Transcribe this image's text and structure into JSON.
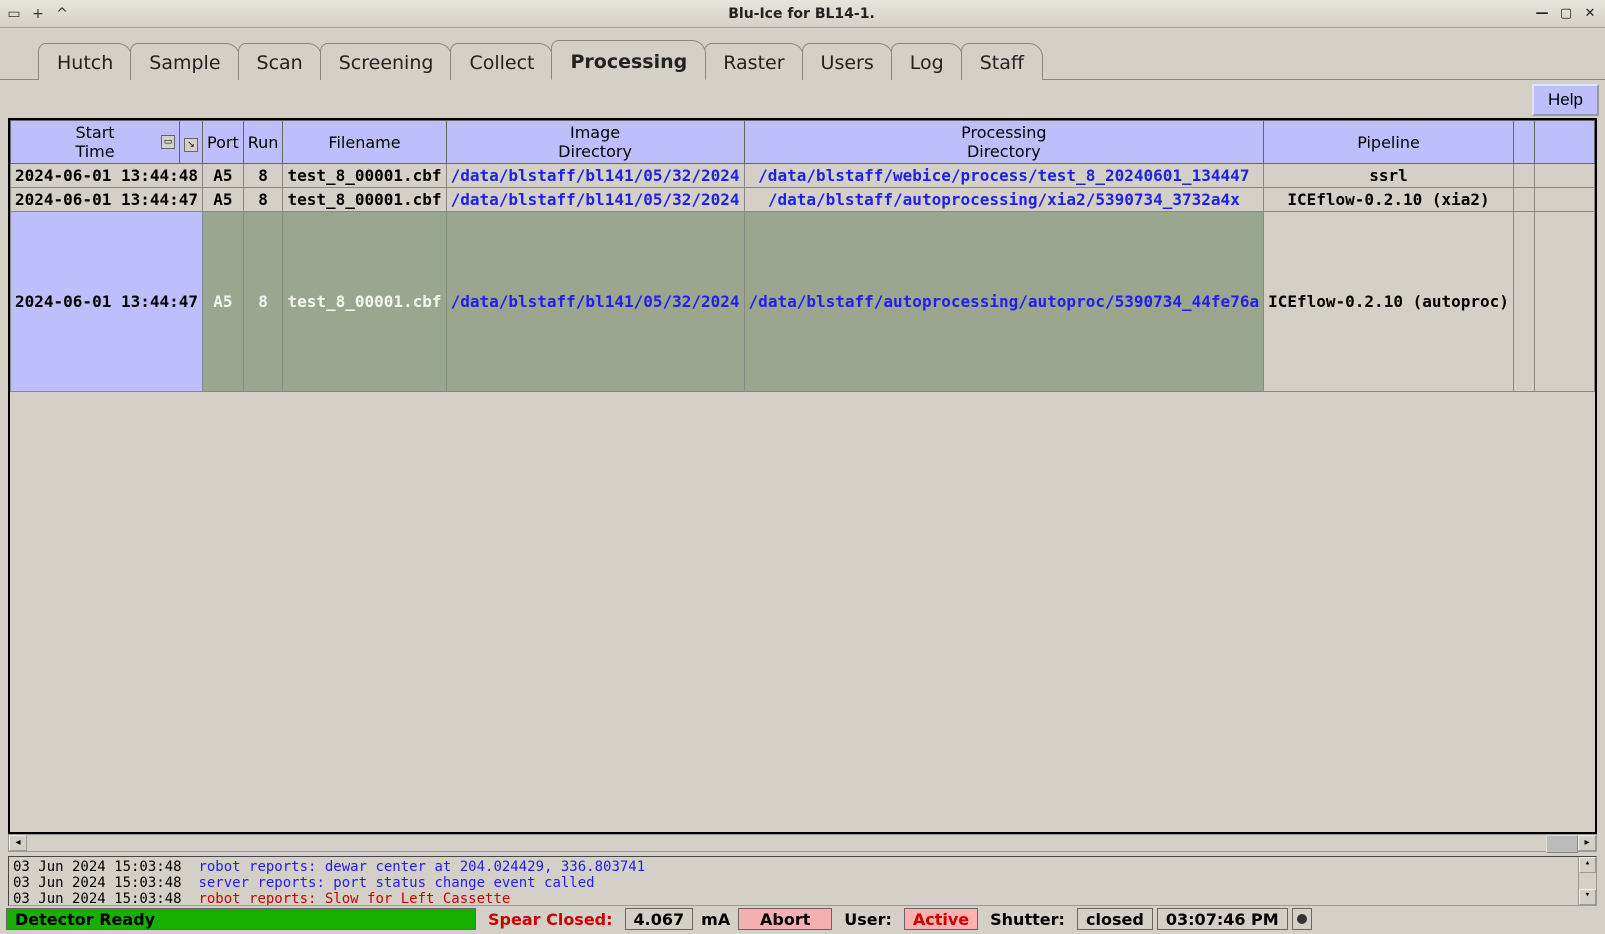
{
  "window": {
    "title": "Blu-Ice for BL14-1."
  },
  "tabs": [
    {
      "label": "Hutch",
      "active": false
    },
    {
      "label": "Sample",
      "active": false
    },
    {
      "label": "Scan",
      "active": false
    },
    {
      "label": "Screening",
      "active": false
    },
    {
      "label": "Collect",
      "active": false
    },
    {
      "label": "Processing",
      "active": true
    },
    {
      "label": "Raster",
      "active": false
    },
    {
      "label": "Users",
      "active": false
    },
    {
      "label": "Log",
      "active": false
    },
    {
      "label": "Staff",
      "active": false
    }
  ],
  "help_label": "Help",
  "table": {
    "headers": {
      "start_time": "Start\nTime",
      "port": "Port",
      "run": "Run",
      "filename": "Filename",
      "image_dir": "Image\nDirectory",
      "proc_dir": "Processing\nDirectory",
      "pipeline": "Pipeline"
    },
    "rows": [
      {
        "start": "2024-06-01 13:44:48",
        "port": "A5",
        "run": "8",
        "filename": "test_8_00001.cbf",
        "image_dir": "/data/blstaff/bl141/05/32/2024",
        "proc_dir": "/data/blstaff/webice/process/test_8_20240601_134447",
        "pipeline": "ssrl",
        "selected": false
      },
      {
        "start": "2024-06-01 13:44:47",
        "port": "A5",
        "run": "8",
        "filename": "test_8_00001.cbf",
        "image_dir": "/data/blstaff/bl141/05/32/2024",
        "proc_dir": "/data/blstaff/autoprocessing/xia2/5390734_3732a4x",
        "pipeline": "ICEflow-0.2.10 (xia2)",
        "selected": false
      },
      {
        "start": "2024-06-01 13:44:47",
        "port": "A5",
        "run": "8",
        "filename": "test_8_00001.cbf",
        "image_dir": "/data/blstaff/bl141/05/32/2024",
        "proc_dir": "/data/blstaff/autoprocessing/autoproc/5390734_44fe76a",
        "pipeline": "ICEflow-0.2.10 (autoproc)",
        "selected": true
      }
    ]
  },
  "log": [
    {
      "ts": "03 Jun 2024 15:03:48",
      "msg": "robot reports: dewar center at 204.024429, 336.803741",
      "color": "blue"
    },
    {
      "ts": "03 Jun 2024 15:03:48",
      "msg": "server reports: port status change event called",
      "color": "blue"
    },
    {
      "ts": "03 Jun 2024 15:03:48",
      "msg": "robot reports: Slow for Left Cassette",
      "color": "red"
    }
  ],
  "status": {
    "detector": "Detector Ready",
    "spear_label": "Spear Closed:",
    "spear_value": "4.067",
    "spear_unit": "mA",
    "abort": "Abort",
    "user_label": "User:",
    "user_value": "Active",
    "shutter_label": "Shutter:",
    "shutter_value": "closed",
    "clock": "03:07:46 PM"
  }
}
